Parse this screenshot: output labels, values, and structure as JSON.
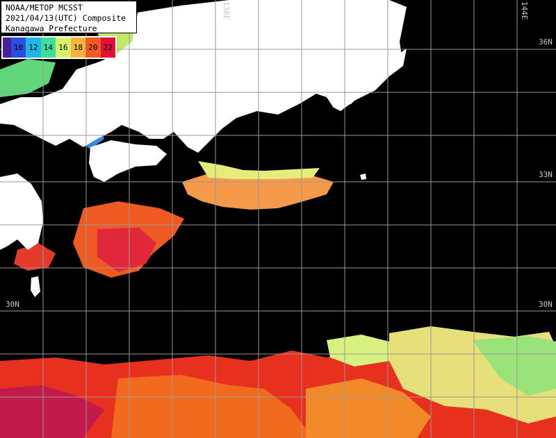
{
  "header": {
    "line1": "NOAA/METOP MCSST",
    "line2": "2021/04/13(UTC) Composite",
    "line3": "Kanagawa Prefecture"
  },
  "legend": {
    "labels": [
      "10",
      "12",
      "14",
      "16",
      "18",
      "20",
      "22"
    ],
    "colors": [
      "#4b1e9a",
      "#2a4fe0",
      "#22b4e6",
      "#3fdc9a",
      "#d9f06a",
      "#f7b341",
      "#f05a24",
      "#e0123a"
    ]
  },
  "grid_labels": {
    "lon_136": "136E",
    "lon_144": "144E",
    "lat_36": "36N",
    "lat_33": "33N",
    "lat_30_left": "30N",
    "lat_30_right": "30N"
  }
}
